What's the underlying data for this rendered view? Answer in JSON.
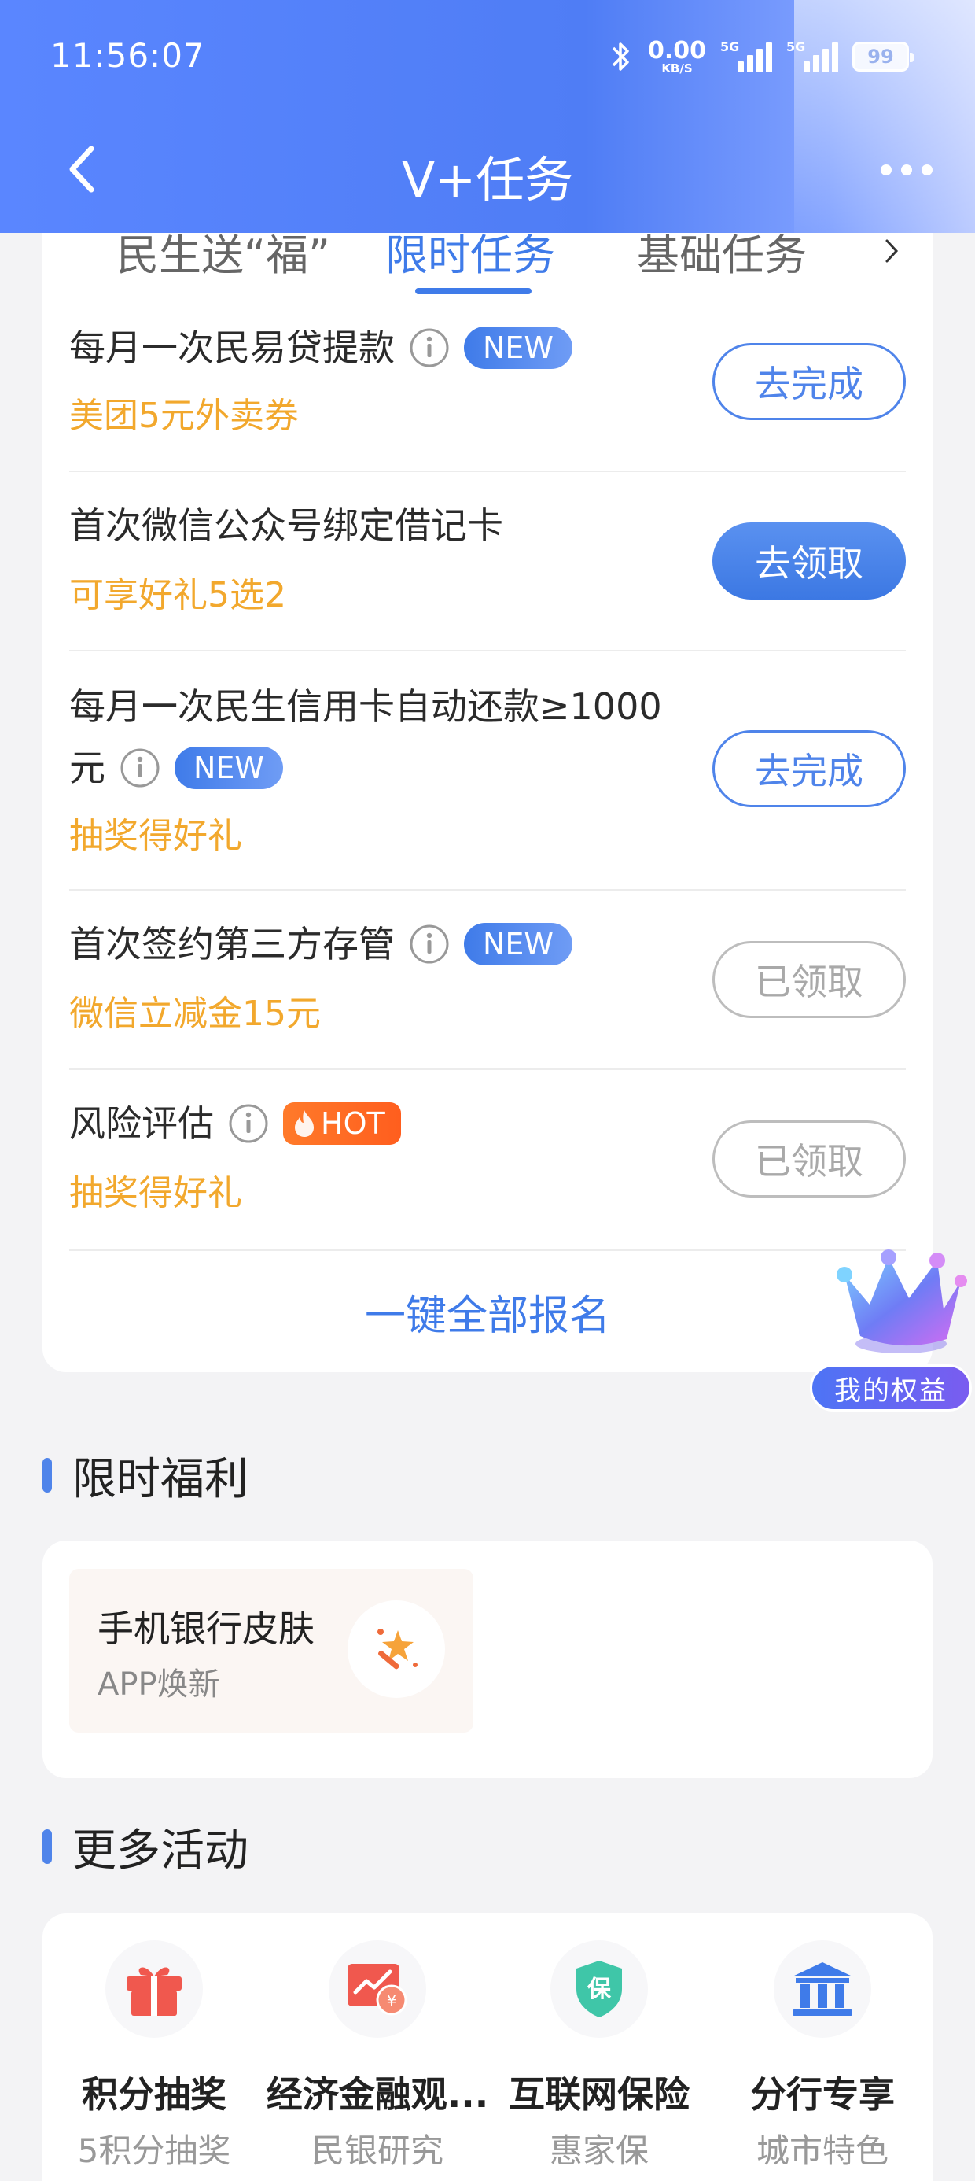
{
  "status_bar": {
    "time": "11:56:07",
    "net_speed": "0.00",
    "net_unit": "KB/S",
    "sim1": "5G",
    "sim2": "5G",
    "battery": "99"
  },
  "nav": {
    "title": "V+任务"
  },
  "tabs": [
    {
      "label": "民生送“福”"
    },
    {
      "label": "限时任务"
    },
    {
      "label": "基础任务"
    }
  ],
  "tasks": [
    {
      "title": "每月一次民易贷提款",
      "badge": "NEW",
      "reward": "美团5元外卖券",
      "action": "去完成"
    },
    {
      "title": "首次微信公众号绑定借记卡",
      "reward": "可享好礼5选2",
      "action": "去领取"
    },
    {
      "title_line1": "每月一次民生信用卡自动还款≥1000",
      "title_line2": "元",
      "badge": "NEW",
      "reward": "抽奖得好礼",
      "action": "去完成"
    },
    {
      "title": "首次签约第三方存管",
      "badge": "NEW",
      "reward": "微信立减金15元",
      "action": "已领取"
    },
    {
      "title": "风险评估",
      "badge": "HOT",
      "reward": "抽奖得好礼",
      "action": "已领取"
    }
  ],
  "enroll_all": "一键全部报名",
  "rights_badge": "我的权益",
  "welfare": {
    "heading": "限时福利",
    "item": {
      "title": "手机银行皮肤",
      "subtitle": "APP焕新"
    }
  },
  "more_activities": {
    "heading": "更多活动",
    "items": [
      {
        "title": "积分抽奖",
        "subtitle": "5积分抽奖",
        "icon": "gift-icon"
      },
      {
        "title": "经济金融观...",
        "subtitle": "民银研究",
        "icon": "chart-icon"
      },
      {
        "title": "互联网保险",
        "subtitle": "惠家保",
        "icon": "shield-icon"
      },
      {
        "title": "分行专享",
        "subtitle": "城市特色",
        "icon": "bank-icon"
      }
    ]
  },
  "colors": {
    "primary": "#3f7be9",
    "reward": "#f2a82d",
    "hot": "#ff6a24"
  }
}
